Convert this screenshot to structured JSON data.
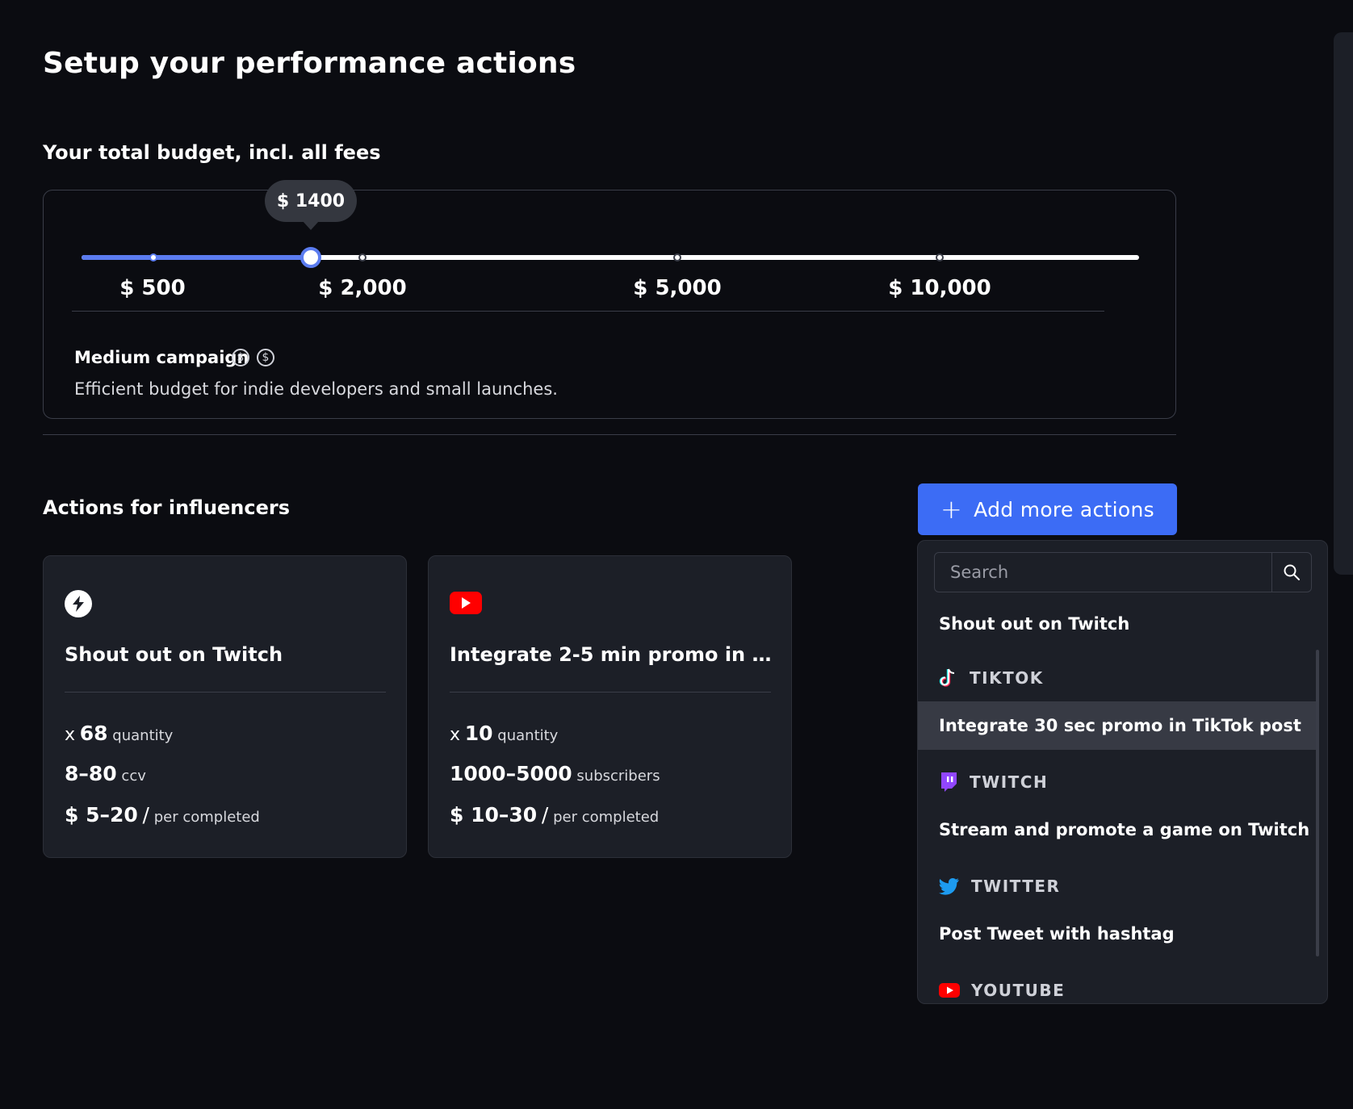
{
  "page": {
    "title": "Setup your performance actions"
  },
  "budget": {
    "heading": "Your total budget, incl. all fees",
    "current_value_label": "$ 1400",
    "current_value": 1400,
    "ticks": [
      "$ 500",
      "$ 2,000",
      "$ 5,000",
      "$ 10,000"
    ],
    "campaign_name": "Medium campaign",
    "campaign_level": 2,
    "campaign_description": "Efficient budget for indie developers and small launches."
  },
  "actions": {
    "heading": "Actions for influencers",
    "add_button_label": "Add more actions",
    "cards": [
      {
        "icon": "bolt-icon",
        "title": "Shout out on Twitch",
        "quantity_prefix": "x",
        "quantity": "68",
        "quantity_unit": "quantity",
        "reach": "8–80",
        "reach_unit": "ccv",
        "price": "$ 5–20",
        "price_sep": "/",
        "price_unit": "per completed"
      },
      {
        "icon": "youtube-icon",
        "title": "Integrate 2-5 min promo in You...",
        "quantity_prefix": "x",
        "quantity": "10",
        "quantity_unit": "quantity",
        "reach": "1000–5000",
        "reach_unit": "subscribers",
        "price": "$ 10–30",
        "price_sep": "/",
        "price_unit": "per completed"
      }
    ]
  },
  "dropdown": {
    "search_placeholder": "Search",
    "items": [
      {
        "label": "Shout out on Twitch"
      }
    ],
    "groups": [
      {
        "name": "TIKTOK",
        "icon": "tiktok-icon",
        "items": [
          "Integrate 30 sec promo in TikTok post"
        ]
      },
      {
        "name": "TWITCH",
        "icon": "twitch-icon",
        "items": [
          "Stream and promote a game on Twitch"
        ]
      },
      {
        "name": "TWITTER",
        "icon": "twitter-icon",
        "items": [
          "Post Tweet with hashtag"
        ]
      },
      {
        "name": "YOUTUBE",
        "icon": "youtube-icon",
        "items": []
      }
    ]
  },
  "colors": {
    "accent": "#3c6cf5",
    "slider": "#5b7cf0",
    "background": "#0b0c11",
    "card": "#1c1f27"
  }
}
